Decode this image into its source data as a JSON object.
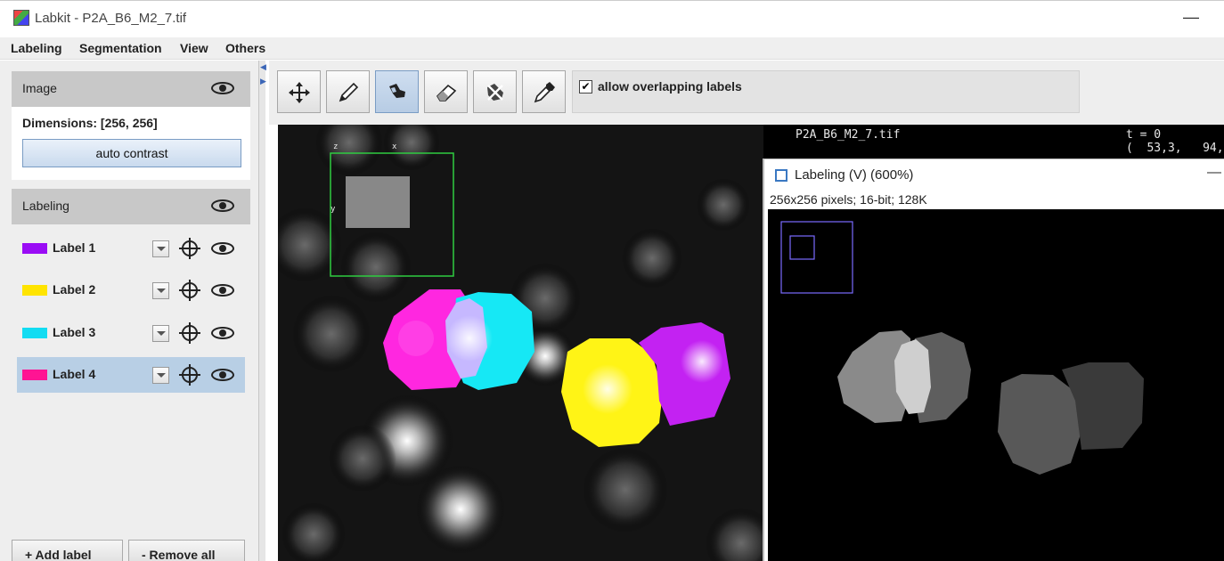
{
  "window": {
    "title": "Labkit - P2A_B6_M2_7.tif",
    "minimize_glyph": "—"
  },
  "menu": [
    "Labeling",
    "Segmentation",
    "View",
    "Others"
  ],
  "image_panel": {
    "title": "Image",
    "dimensions": "Dimensions: [256, 256]",
    "auto_contrast_label": "auto contrast"
  },
  "labeling_panel": {
    "title": "Labeling",
    "labels": [
      {
        "name": "Label 1",
        "color": "#9a0cf5",
        "selected": false
      },
      {
        "name": "Label 2",
        "color": "#ffe400",
        "selected": false
      },
      {
        "name": "Label 3",
        "color": "#12dcf2",
        "selected": false
      },
      {
        "name": "Label 4",
        "color": "#ff1493",
        "selected": true
      }
    ],
    "add_label": "+ Add label",
    "remove_all": "- Remove all"
  },
  "toolbar": {
    "tools": [
      "move-icon",
      "pencil-icon",
      "flood-fill-icon",
      "eraser-icon",
      "flood-erase-icon",
      "pipette-icon"
    ],
    "active_tool": "flood-fill-icon",
    "allow_overlapping_checked": true,
    "allow_overlapping_label": "allow overlapping labels"
  },
  "canvas_overlay": {
    "filename": "P2A_B6_M2_7.tif",
    "time": "t = 0",
    "coords": "(  53,3,   94,",
    "axis_z": "z",
    "axis_x": "x",
    "axis_y": "y"
  },
  "ij_window": {
    "title": "Labeling (V) (600%)",
    "info": "256x256 pixels; 16-bit; 128K",
    "minimize_glyph": "—"
  }
}
